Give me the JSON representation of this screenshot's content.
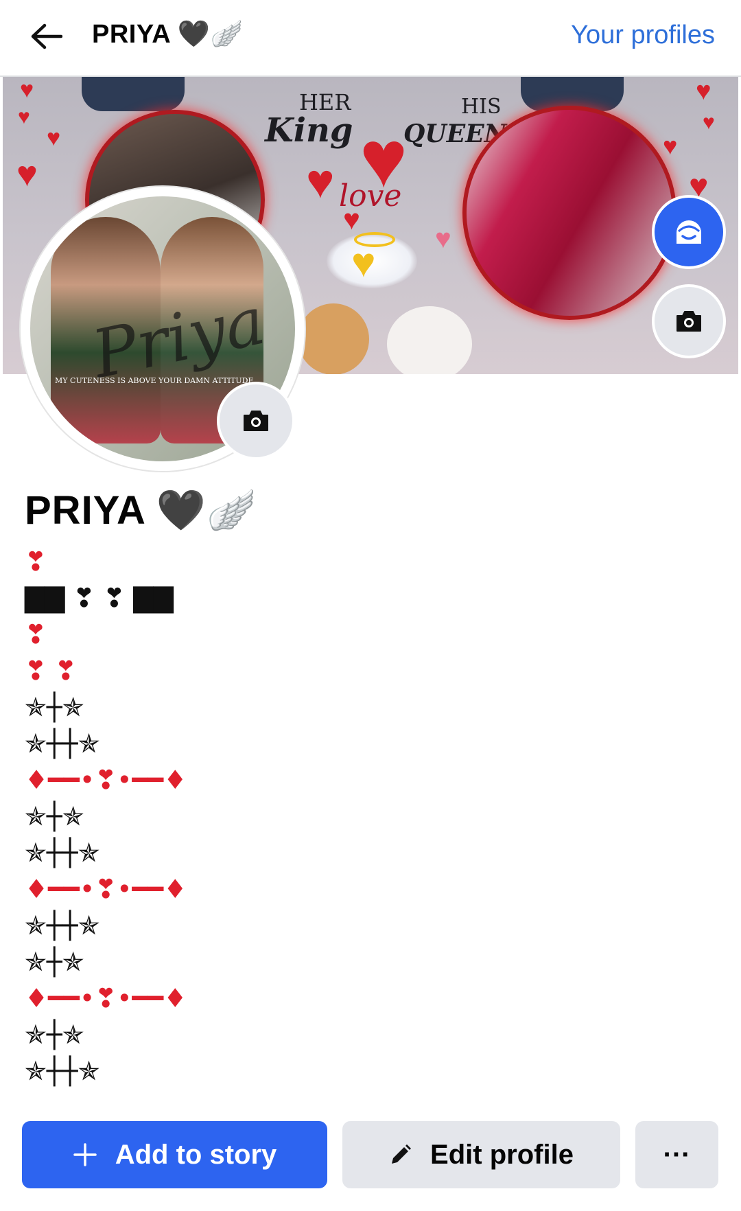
{
  "header": {
    "title": "PRIYA 🖤🪽",
    "your_profiles": "Your profiles"
  },
  "cover": {
    "her_text": "HER",
    "king_text": "King",
    "his_text": "HIS",
    "queen_text": "QUEEN",
    "love_text": "love"
  },
  "avatar": {
    "script_text": "Priya",
    "caption_text": "MY CUTENESS IS ABOVE YOUR DAMN ATTITUDE"
  },
  "profile": {
    "name": "PRIYA 🖤🪽"
  },
  "bio_lines": [
    "❣",
    "▇▇ ❣ ❣ ▇▇",
    "❣",
    "❣ ❣",
    "✯┼✯",
    "✯┼┼✯",
    "♦━━•❣•━━♦",
    "✯┼✯",
    "✯┼┼✯",
    "♦━━•❣•━━♦",
    "✯┼┼✯",
    "✯┼✯",
    "♦━━•❣•━━♦",
    "✯┼✯",
    "✯┼┼✯"
  ],
  "actions": {
    "add_story": "Add to story",
    "edit_profile": "Edit profile",
    "more": "···"
  },
  "icons": {
    "back": "arrow-left-icon",
    "avatar_button": "avatar-face-icon",
    "camera": "camera-icon",
    "plus": "plus-icon",
    "pencil": "pencil-icon"
  },
  "colors": {
    "link_blue": "#2e6fd9",
    "primary_blue": "#2d64f0",
    "secondary_gray": "#e4e6eb",
    "accent_red": "#e0202d"
  }
}
